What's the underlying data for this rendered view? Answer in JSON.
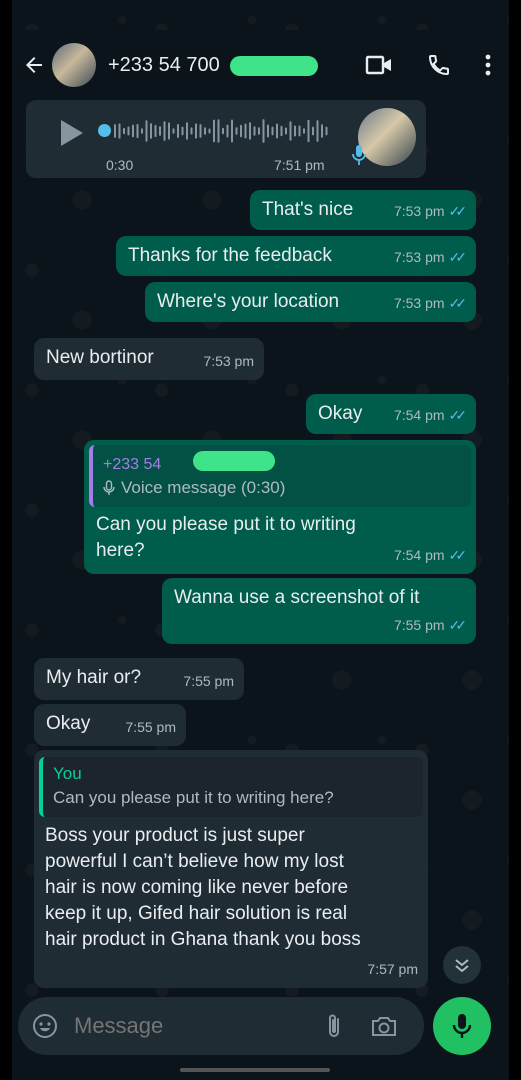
{
  "header": {
    "contact": "+233 54 700",
    "icons": [
      "back-arrow-icon",
      "video-call-icon",
      "phone-icon",
      "more-vert-icon"
    ]
  },
  "voice_note": {
    "duration": "0:30",
    "time": "7:51 pm"
  },
  "messages": [
    {
      "id": "m1",
      "dir": "out",
      "text": "That's nice",
      "time": "7:53 pm"
    },
    {
      "id": "m2",
      "dir": "out",
      "text": "Thanks for the feedback",
      "time": "7:53 pm"
    },
    {
      "id": "m3",
      "dir": "out",
      "text": "Where's your location",
      "time": "7:53 pm"
    },
    {
      "id": "m4",
      "dir": "in",
      "text": "New bortinor",
      "time": "7:53 pm"
    },
    {
      "id": "m5",
      "dir": "out",
      "text": "Okay",
      "time": "7:54 pm"
    },
    {
      "id": "m6",
      "dir": "out",
      "quote_author": "+233 54",
      "quote_text": "Voice message (0:30)",
      "text_line1": "Can you please put it to writing",
      "text_line2": "here?",
      "time": "7:54 pm"
    },
    {
      "id": "m7",
      "dir": "out",
      "text": "Wanna use a screenshot of it",
      "time": "7:55 pm"
    },
    {
      "id": "m8",
      "dir": "in",
      "text": "My hair or?",
      "time": "7:55 pm"
    },
    {
      "id": "m9",
      "dir": "in",
      "text": "Okay",
      "time": "7:55 pm"
    },
    {
      "id": "m10",
      "dir": "in",
      "quote_author": "You",
      "quote_text": "Can you please put it to writing here?",
      "lines": [
        "Boss your product is just super",
        "powerful I can’t believe how my lost",
        "hair is now coming like never before",
        "keep it up, Gifed hair solution is real",
        "hair product in Ghana thank you boss"
      ],
      "time": "7:57 pm"
    }
  ],
  "composer": {
    "placeholder": "Message"
  },
  "colors": {
    "outgoing_bubble": "#005c4b",
    "incoming_bubble": "#202c33",
    "read_ticks": "#53bdeb",
    "mic_button": "#21c063",
    "redaction": "#3fe48a"
  }
}
